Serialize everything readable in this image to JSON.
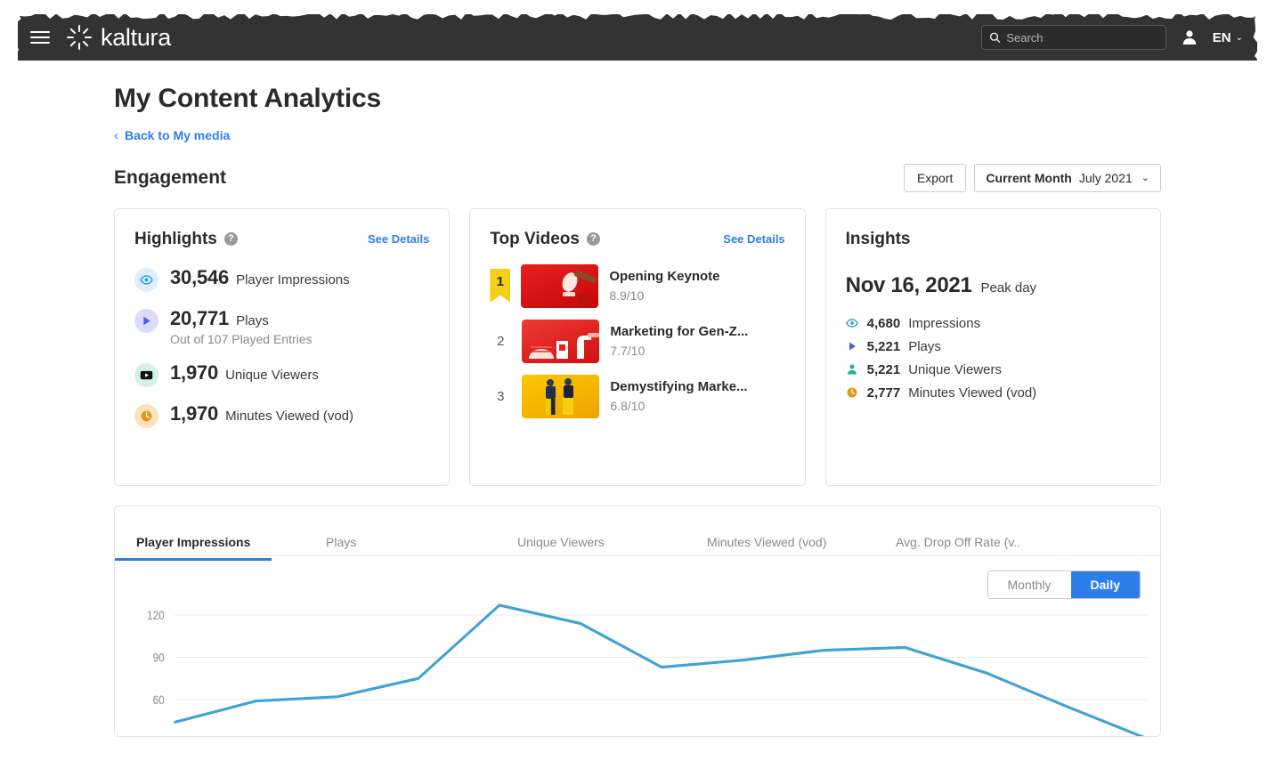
{
  "topbar": {
    "menu_icon": "hamburger-icon",
    "brand": "kaltura",
    "brand_logo_icon": "kaltura-sunburst-icon",
    "search": {
      "placeholder": "Search",
      "value": "",
      "icon": "search-icon"
    },
    "user_icon": "user-avatar-icon",
    "language": "EN",
    "language_chevron": "⌄"
  },
  "page": {
    "title": "My Content Analytics",
    "back_link": "Back to My media",
    "back_chevron": "‹",
    "section_title": "Engagement",
    "export_label": "Export",
    "date_picker": {
      "label": "Current Month",
      "value": "July 2021",
      "chevron": "⌄"
    }
  },
  "highlights": {
    "title": "Highlights",
    "help_glyph": "?",
    "see_details": "See Details",
    "rows": [
      {
        "icon": "eye-icon",
        "icon_bg": "#ddeffc",
        "icon_color": "#2e9fe0",
        "value": "30,546",
        "label": "Player Impressions",
        "sub": ""
      },
      {
        "icon": "play-icon",
        "icon_bg": "#dcdcfa",
        "icon_color": "#4a5ee8",
        "value": "20,771",
        "label": "Plays",
        "sub": "Out of 107 Played Entries"
      },
      {
        "icon": "video-icon",
        "icon_bg": "#d4f0e7",
        "icon_color": "#111111",
        "value": "1,970",
        "label": "Unique Viewers",
        "sub": ""
      },
      {
        "icon": "clock-icon",
        "icon_bg": "#fbe3bd",
        "icon_color": "#e8950f",
        "value": "1,970",
        "label": "Minutes Viewed (vod)",
        "sub": ""
      }
    ]
  },
  "top_videos": {
    "title": "Top Videos",
    "help_glyph": "?",
    "see_details": "See Details",
    "rows": [
      {
        "rank": "1",
        "name": "Opening Keynote",
        "score": "8.9/10",
        "thumb": "red-podium-thumbnail",
        "thumb_from": "#e8201f",
        "thumb_to": "#c4080a"
      },
      {
        "rank": "2",
        "name": "Marketing for Gen-Z...",
        "score": "7.7/10",
        "thumb": "red-objects-thumbnail",
        "thumb_from": "#ee3b32",
        "thumb_to": "#d11014"
      },
      {
        "rank": "3",
        "name": "Demystifying Marke...",
        "score": "6.8/10",
        "thumb": "yellow-people-thumbnail",
        "thumb_from": "#fbc800",
        "thumb_to": "#eea400"
      }
    ]
  },
  "insights": {
    "title": "Insights",
    "peak_date": "Nov 16, 2021",
    "peak_label": "Peak day",
    "rows": [
      {
        "icon": "eye-icon",
        "color": "#2e9fe0",
        "value": "4,680",
        "label": "Impressions"
      },
      {
        "icon": "play-icon",
        "color": "#4a5ee8",
        "value": "5,221",
        "label": "Plays"
      },
      {
        "icon": "person-icon",
        "color": "#22b09a",
        "value": "5,221",
        "label": "Unique Viewers"
      },
      {
        "icon": "clock-icon",
        "color": "#e8950f",
        "value": "2,777",
        "label": "Minutes Viewed (vod)"
      }
    ]
  },
  "chart_panel": {
    "tabs": [
      {
        "label": "Player Impressions",
        "active": true
      },
      {
        "label": "Plays",
        "active": false
      },
      {
        "label": "Unique Viewers",
        "active": false
      },
      {
        "label": "Minutes Viewed (vod)",
        "active": false
      },
      {
        "label": "Avg. Drop Off Rate (v..",
        "active": false
      }
    ],
    "granularity": [
      {
        "label": "Monthly",
        "active": false
      },
      {
        "label": "Daily",
        "active": true
      }
    ]
  },
  "chart_data": {
    "type": "line",
    "title": "Player Impressions",
    "xlabel": "",
    "ylabel": "",
    "ylim": [
      0,
      140
    ],
    "yticks": [
      60,
      90,
      120
    ],
    "ytick_labels": [
      "60",
      "90",
      "120"
    ],
    "grid": true,
    "legend": false,
    "line_color": "#41a2d4",
    "x": [
      1,
      2,
      3,
      4,
      5,
      6,
      7,
      8,
      9,
      10,
      11,
      12,
      13
    ],
    "values": [
      44,
      59,
      62,
      75,
      127,
      114,
      83,
      88,
      95,
      97,
      79,
      55,
      32
    ],
    "series": [
      {
        "name": "Player Impressions",
        "values": [
          44,
          59,
          62,
          75,
          127,
          114,
          83,
          88,
          95,
          97,
          79,
          55,
          32
        ]
      }
    ]
  }
}
